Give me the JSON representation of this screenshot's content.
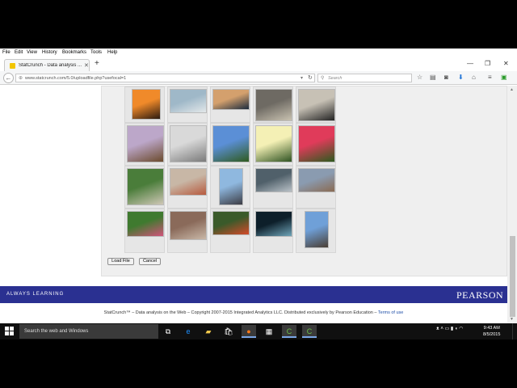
{
  "browser": {
    "menu": [
      "File",
      "Edit",
      "View",
      "History",
      "Bookmarks",
      "Tools",
      "Help"
    ],
    "tab_title": "StatCrunch - Data analysis ...",
    "url": "www.statcrunch.com/5.0/uploadfile.php?usefocal=1",
    "search_placeholder": "Search"
  },
  "gallery": {
    "rows": [
      [
        {
          "colors": [
            "#f08a2a",
            "#2b1a10"
          ]
        },
        {
          "colors": [
            "#9fb8c8",
            "#e3e8e9"
          ]
        },
        {
          "colors": [
            "#d4a06d",
            "#1b2b3e"
          ]
        },
        {
          "colors": [
            "#6e6a63",
            "#c9c2b1"
          ]
        },
        {
          "colors": [
            "#c7c1b5",
            "#222222"
          ]
        }
      ],
      [
        {
          "colors": [
            "#bca7c9",
            "#6b4a2c"
          ]
        },
        {
          "colors": [
            "#d9d9d9",
            "#7a7a7a"
          ]
        },
        {
          "colors": [
            "#5b8fd6",
            "#2f5a1e"
          ]
        },
        {
          "colors": [
            "#f4f0b5",
            "#2e5221"
          ]
        },
        {
          "colors": [
            "#e03b5a",
            "#2c5a1e"
          ]
        }
      ],
      [
        {
          "colors": [
            "#4a7d3a",
            "#cfc7b6"
          ]
        },
        {
          "colors": [
            "#c8b7a6",
            "#b75a3e"
          ]
        },
        {
          "colors": [
            "#8fb8df",
            "#3c3c44"
          ]
        },
        {
          "colors": [
            "#50606a",
            "#b9c1c7"
          ]
        },
        {
          "colors": [
            "#8a9bb0",
            "#8a6a52"
          ]
        }
      ],
      [
        {
          "colors": [
            "#3f7a2f",
            "#d1537a"
          ]
        },
        {
          "colors": [
            "#8a6a5a",
            "#c9b8a8"
          ]
        },
        {
          "colors": [
            "#3a5a2a",
            "#d44a2a"
          ]
        },
        {
          "colors": [
            "#0d1f2a",
            "#6fa4b8"
          ]
        },
        {
          "colors": [
            "#6fa0d8",
            "#4a3e33"
          ]
        }
      ]
    ]
  },
  "buttons": {
    "load_file": "Load File",
    "cancel": "Cancel"
  },
  "banner": {
    "tagline": "ALWAYS LEARNING",
    "logo": "PEARSON"
  },
  "footer": {
    "text": "StatCrunch™ – Data analysis on the Web – Copyright 2007-2015 Integrated Analytics LLC. Distributed exclusively by Pearson Education –",
    "link": "Terms of use"
  },
  "taskbar": {
    "search_placeholder": "Search the web and Windows",
    "time": "9:43 AM",
    "date": "8/5/2015"
  }
}
